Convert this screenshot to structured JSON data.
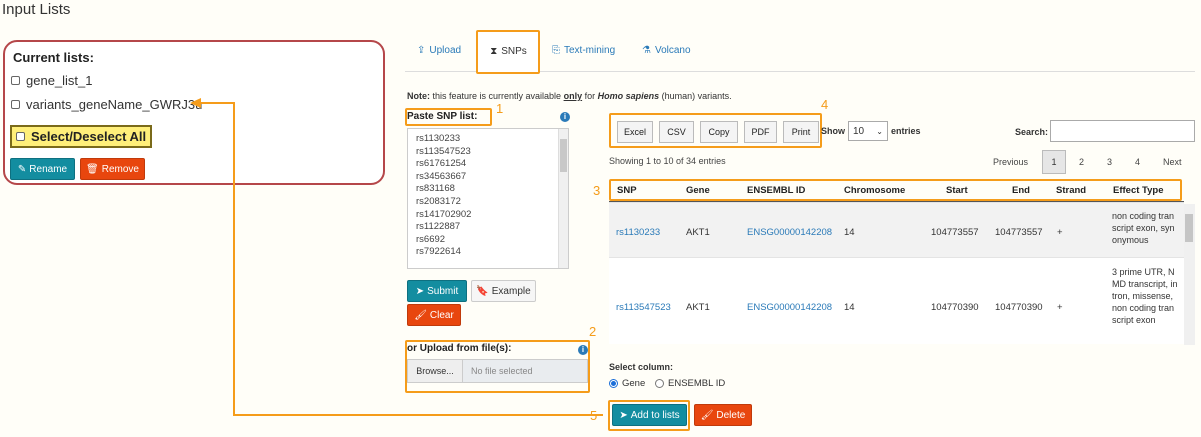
{
  "page_title": "Input Lists",
  "lists_panel": {
    "title": "Current lists:",
    "items": [
      "gene_list_1",
      "variants_geneName_GWRJ3u"
    ],
    "select_all_label": "Select/Deselect All",
    "rename_label": "Rename",
    "remove_label": "Remove"
  },
  "tabs": {
    "upload": "Upload",
    "snps": "SNPs",
    "text_mining": "Text-mining",
    "volcano": "Volcano"
  },
  "note": {
    "prefix": "Note:",
    "text1": " this feature is currently available ",
    "only": "only",
    "text2": " for ",
    "species": "Homo sapiens",
    "text3": " (human) variants."
  },
  "snp_input": {
    "label": "Paste SNP list:",
    "lines": [
      "rs1130233",
      "rs113547523",
      "rs61761254",
      "rs34563667",
      "rs831168",
      "rs2083172",
      "rs141702902",
      "rs1122887",
      "rs6692",
      "rs7922614"
    ],
    "submit_label": "Submit",
    "example_label": "Example",
    "clear_label": "Clear"
  },
  "file_upload": {
    "label": "or Upload from file(s):",
    "browse_label": "Browse...",
    "placeholder": "No file selected"
  },
  "table_tools": {
    "buttons": [
      "Excel",
      "CSV",
      "Copy",
      "PDF",
      "Print"
    ],
    "show_label": "Show",
    "entries_value": "10",
    "entries_label": "entries",
    "search_label": "Search:",
    "showing_text": "Showing 1 to 10 of 34 entries",
    "pagination": {
      "previous": "Previous",
      "pages": [
        "1",
        "2",
        "3",
        "4"
      ],
      "next": "Next",
      "current": "1"
    }
  },
  "table": {
    "headers": [
      "SNP",
      "Gene",
      "ENSEMBL ID",
      "Chromosome",
      "Start",
      "End",
      "Strand",
      "Effect Type"
    ],
    "rows": [
      {
        "snp": "rs1130233",
        "gene": "AKT1",
        "ensembl": "ENSG00000142208",
        "chromosome": "14",
        "start": "104773557",
        "end": "104773557",
        "strand": "+",
        "effect": "non coding transcript exon, synonymous"
      },
      {
        "snp": "rs113547523",
        "gene": "AKT1",
        "ensembl": "ENSG00000142208",
        "chromosome": "14",
        "start": "104770390",
        "end": "104770390",
        "strand": "+",
        "effect": "3 prime UTR, NMD transcript, intron, missense, non coding transcript exon"
      }
    ]
  },
  "select_column": {
    "label": "Select column:",
    "options": [
      "Gene",
      "ENSEMBL ID"
    ],
    "selected": "Gene"
  },
  "actions": {
    "add_label": "Add to lists",
    "delete_label": "Delete"
  },
  "callouts": [
    "1",
    "2",
    "3",
    "4",
    "5"
  ],
  "colors": {
    "callout": "#f59c1a",
    "panel_border": "#b5474a",
    "teal": "#138da0",
    "orange_red": "#e8460e",
    "link": "#2a7ab8"
  }
}
